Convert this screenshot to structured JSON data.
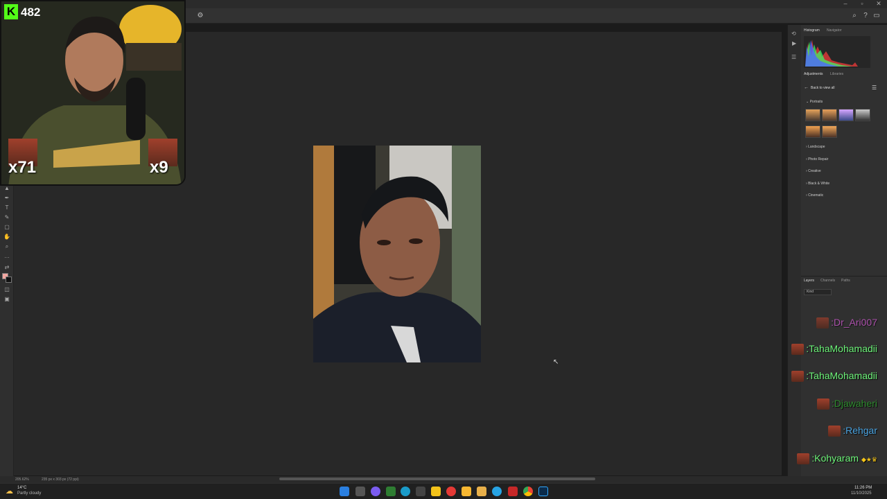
{
  "photoshop": {
    "panels": {
      "top_tabs": [
        "Histogram",
        "Navigator"
      ],
      "adjust_tabs": [
        "Adjustments",
        "Libraries"
      ],
      "back_label": "Back to view all",
      "groups": [
        "Portraits",
        "Landscape",
        "Photo Repair",
        "Creative",
        "Black & White",
        "Cinematic"
      ],
      "layers_tabs": [
        "Layers",
        "Channels",
        "Paths"
      ],
      "layers_kind": "Kind"
    },
    "status": {
      "zoom": "205.62%",
      "doc_info": "235 px x 303 px (72 ppi)"
    }
  },
  "stream": {
    "viewer_count": "482",
    "multipliers": [
      "x71",
      "x9"
    ]
  },
  "chat": [
    {
      "user": ":Dr_Ari007",
      "color": "#e05fe0"
    },
    {
      "user": ":TahaMohamadii",
      "color": "#6ef57a"
    },
    {
      "user": ":TahaMohamadii",
      "color": "#6ef57a"
    },
    {
      "user": ":Djawaheri",
      "color": "#2e8b2e"
    },
    {
      "user": ":Rehgar",
      "color": "#4aa3e0"
    },
    {
      "user": ":Kohyaram",
      "color": "#6ef57a"
    }
  ],
  "taskbar": {
    "weather_temp": "14°C",
    "weather_desc": "Partly cloudy",
    "time": "11:26 PM",
    "date": "11/10/2025"
  }
}
